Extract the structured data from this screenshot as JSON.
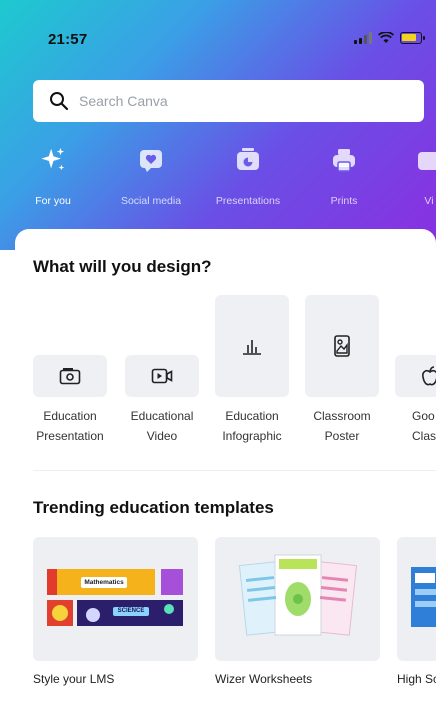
{
  "status": {
    "time": "21:57"
  },
  "search": {
    "placeholder": "Search Canva"
  },
  "categories": [
    {
      "label": "For you",
      "icon": "sparkle-icon"
    },
    {
      "label": "Social media",
      "icon": "heart-icon"
    },
    {
      "label": "Presentations",
      "icon": "presentation-icon"
    },
    {
      "label": "Prints",
      "icon": "printer-icon"
    },
    {
      "label": "Vi",
      "icon": "video-icon"
    }
  ],
  "design": {
    "heading": "What will you design?",
    "items": [
      {
        "line1": "Education",
        "line2": "Presentation",
        "icon": "presentation-screen-icon"
      },
      {
        "line1": "Educational",
        "line2": "Video",
        "icon": "video-camera-icon"
      },
      {
        "line1": "Education",
        "line2": "Infographic",
        "icon": "bar-chart-icon"
      },
      {
        "line1": "Classroom",
        "line2": "Poster",
        "icon": "poster-icon"
      },
      {
        "line1": "Goo",
        "line2": "Classr",
        "icon": "apple-icon"
      }
    ]
  },
  "trending": {
    "heading": "Trending education templates",
    "cards": [
      {
        "label": "Style your LMS",
        "tag1": "Mathematics",
        "tag2": "SCIENCE"
      },
      {
        "label": "Wizer Worksheets"
      },
      {
        "label": "High Sc"
      }
    ]
  },
  "colors": {
    "accent_top": "#1ec9cf",
    "accent_mid": "#6a4fe6",
    "accent_end": "#8a2fe0"
  }
}
